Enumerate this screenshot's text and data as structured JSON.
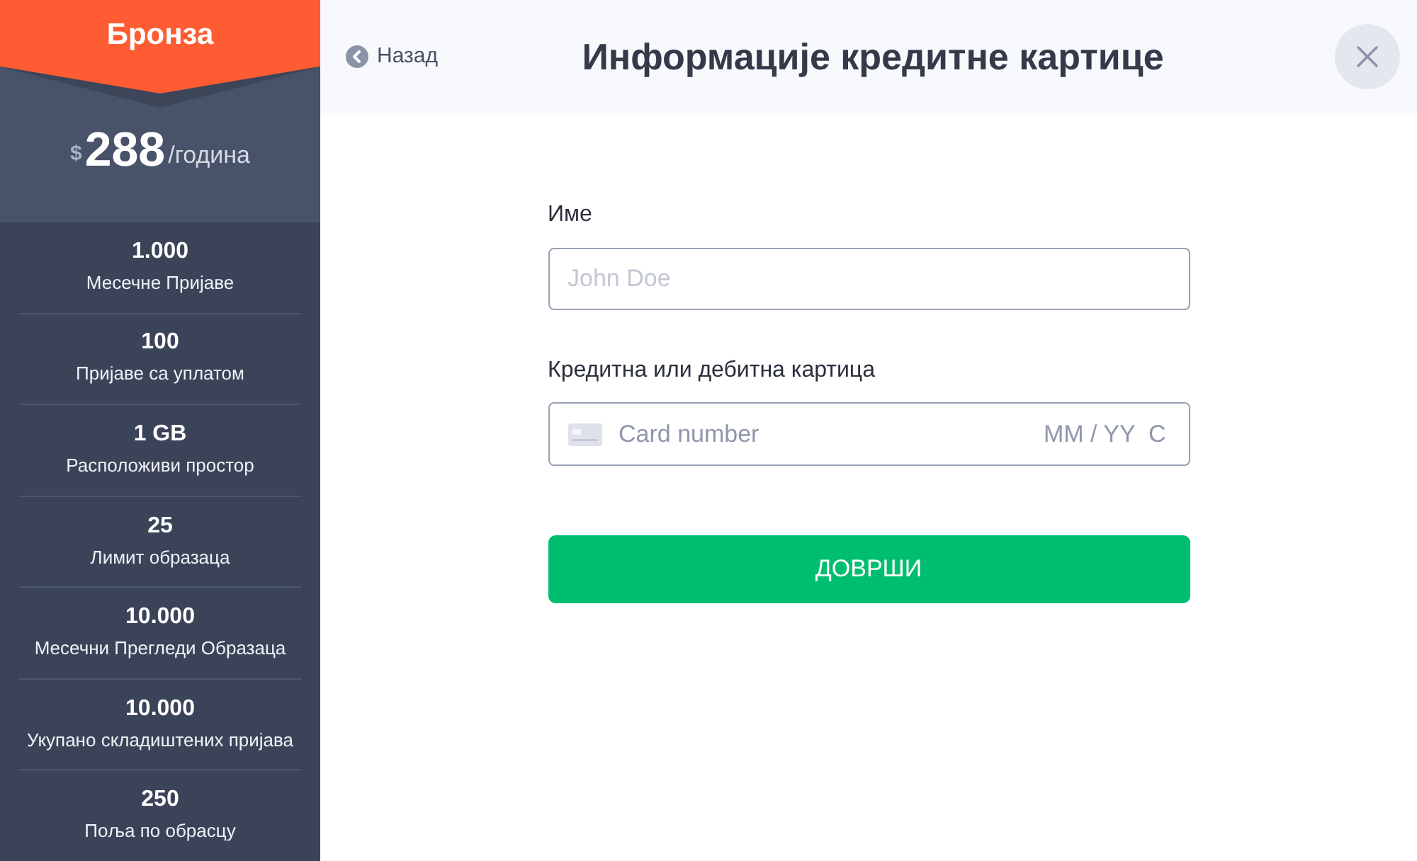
{
  "plan": {
    "name": "Бронза",
    "price": {
      "currency": "$",
      "amount": "288",
      "period": "/година"
    },
    "features": [
      {
        "value": "1.000",
        "label": "Месечне Пријаве"
      },
      {
        "value": "100",
        "label": "Пријаве са уплатом"
      },
      {
        "value": "1 GB",
        "label": "Расположиви простор"
      },
      {
        "value": "25",
        "label": "Лимит образаца"
      },
      {
        "value": "10.000",
        "label": "Месечни Прегледи Образаца"
      },
      {
        "value": "10.000",
        "label": "Укупано складиштених пријава"
      },
      {
        "value": "250",
        "label": "Поља по обрасцу"
      }
    ]
  },
  "header": {
    "back_label": "Назад",
    "title": "Информације кредитне картице"
  },
  "form": {
    "fields": [
      {
        "kind": "text",
        "label": "Име",
        "placeholder": "John Doe"
      },
      {
        "kind": "card",
        "label": "Кредитна или дебитна картица",
        "placeholder": "Card number",
        "expiry_placeholder": "MM / YY",
        "cvc_placeholder": "C"
      }
    ],
    "submit_label": "ДОВРШИ"
  }
}
